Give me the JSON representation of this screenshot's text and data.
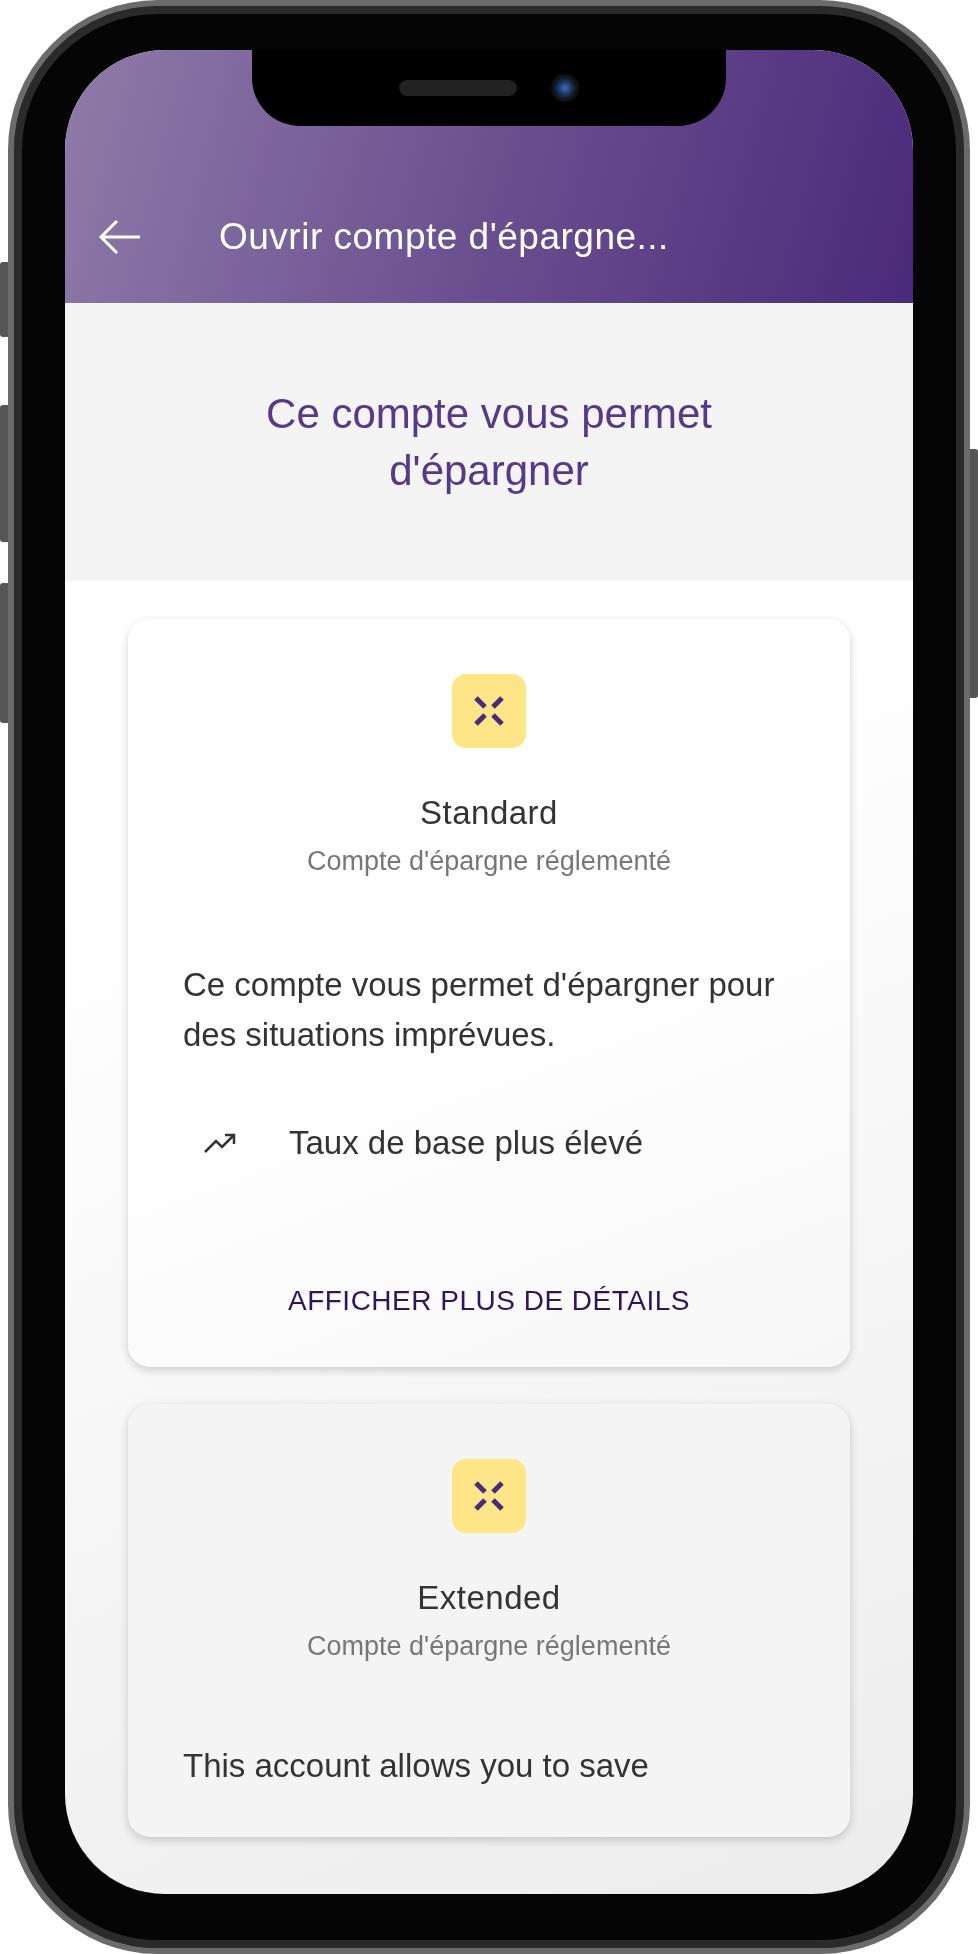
{
  "header": {
    "title": "Ouvrir compte d'épargne..."
  },
  "intro": {
    "heading": "Ce compte vous permet d'épargner"
  },
  "accounts": [
    {
      "name": "Standard",
      "subtitle": "Compte d'épargne réglementé",
      "description": "Ce compte vous permet d'épargner pour des situations imprévues.",
      "features": [
        {
          "text": "Taux de base plus élevé"
        }
      ],
      "action": "AFFICHER PLUS DE DÉTAILS"
    },
    {
      "name": "Extended",
      "subtitle": "Compte d'épargne réglementé",
      "description": "This account allows you to save"
    }
  ]
}
